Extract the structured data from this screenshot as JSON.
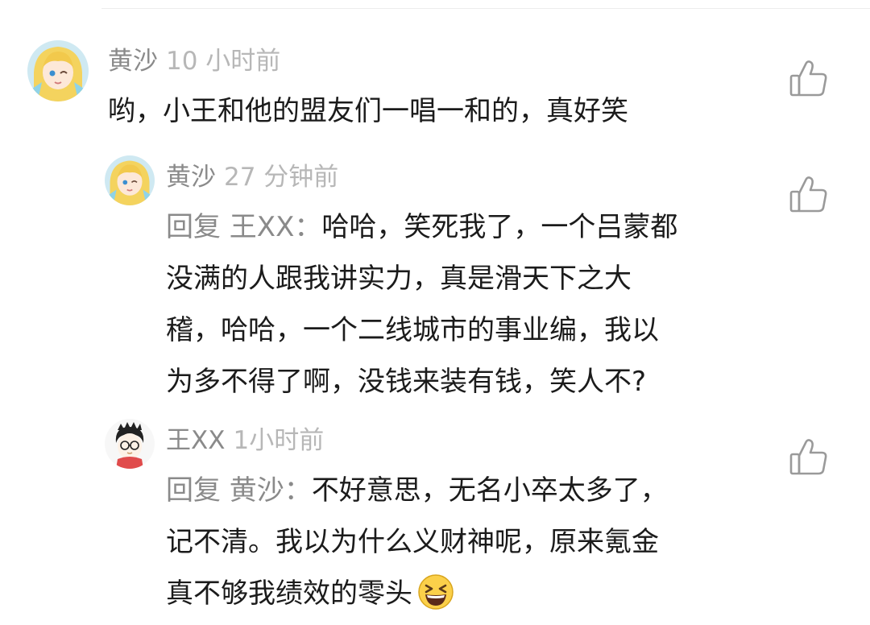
{
  "comments": [
    {
      "author": "黄沙",
      "time": "10 小时前",
      "lines": [
        "哟，小王和他的盟友们一唱一和的，真好笑"
      ]
    },
    {
      "author": "黄沙",
      "time": "27 分钟前",
      "reply_prefix": "回复 王XX：",
      "lines": [
        "哈哈，笑死我了，一个吕蒙都",
        "没满的人跟我讲实力，真是滑天下之大",
        "稽，哈哈，一个二线城市的事业编，我以",
        "为多不得了啊，没钱来装有钱，笑人不?"
      ]
    },
    {
      "author": "王XX",
      "time": "1小时前",
      "reply_prefix": "回复 黄沙：",
      "lines": [
        "不好意思，无名小卒太多了，",
        "记不清。我以为什么义财神呢，原来氪金",
        "真不够我绩效的零头"
      ],
      "emoji": "grinning-squint-emoji"
    }
  ],
  "icons": {
    "like": "thumbs-up-icon"
  },
  "colors": {
    "name": "#8a8a8a",
    "time": "#b7b7b7",
    "text": "#1b1b1b",
    "icon": "#9a9a9a"
  }
}
